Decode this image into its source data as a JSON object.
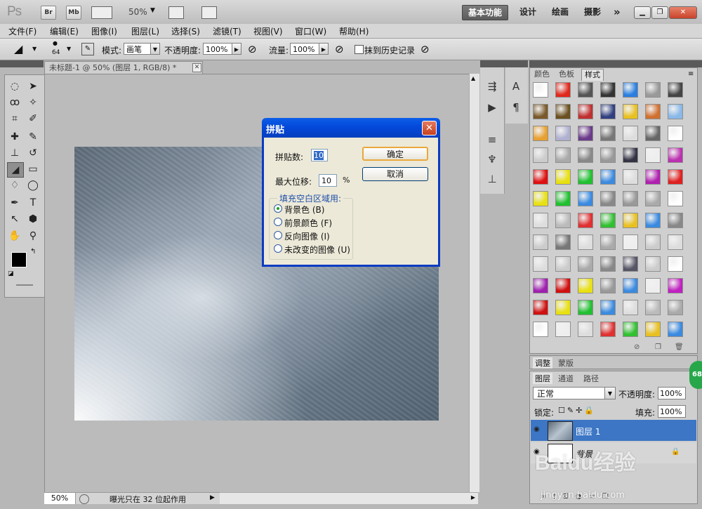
{
  "app": {
    "logo": "Ps",
    "bridge": "Br",
    "minibridge": "Mb",
    "zoom": "50%",
    "workspaces": [
      "基本功能",
      "设计",
      "绘画",
      "摄影"
    ],
    "more": "»"
  },
  "menu": [
    "文件(F)",
    "编辑(E)",
    "图像(I)",
    "图层(L)",
    "选择(S)",
    "滤镜(T)",
    "视图(V)",
    "窗口(W)",
    "帮助(H)"
  ],
  "options": {
    "brush_size": "64",
    "mode_label": "模式:",
    "mode_value": "画笔",
    "opacity_label": "不透明度:",
    "opacity_value": "100%",
    "flow_label": "流量:",
    "flow_value": "100%",
    "history_label": "抹到历史记录"
  },
  "document": {
    "tab_title": "未标题-1 @ 50% (图层 1, RGB/8) *",
    "zoom_status": "50%",
    "status_text": "曝光只在 32 位起作用"
  },
  "dialog": {
    "title": "拼贴",
    "tiles_label": "拼贴数:",
    "tiles_value": "10",
    "offset_label": "最大位移:",
    "offset_value": "10",
    "offset_unit": "%",
    "ok": "确定",
    "cancel": "取消",
    "group_label": "填充空白区域用:",
    "options": [
      "背景色 (B)",
      "前景颜色 (F)",
      "反向图像 (I)",
      "未改变的图像 (U)"
    ],
    "selected_index": 0
  },
  "styles_panel": {
    "tabs": [
      "颜色",
      "色板",
      "样式"
    ],
    "active_tab": 2
  },
  "adjust_panel": {
    "tabs": [
      "调整",
      "蒙版"
    ]
  },
  "layers_panel": {
    "tabs": [
      "图层",
      "通道",
      "路径"
    ],
    "blend_mode": "正常",
    "opacity_label": "不透明度:",
    "opacity_value": "100%",
    "lock_label": "锁定:",
    "fill_label": "填充:",
    "fill_value": "100%",
    "layers": [
      {
        "name": "图层 1",
        "selected": true
      },
      {
        "name": "背景",
        "selected": false
      }
    ]
  },
  "watermark": {
    "logo": "Baidu经验",
    "url": "jingyan.baidu.com"
  },
  "badge": "68",
  "colors": {
    "accent": "#316ac5",
    "dialog_title": "#0347d8",
    "dialog_bg": "#ece9d8"
  }
}
